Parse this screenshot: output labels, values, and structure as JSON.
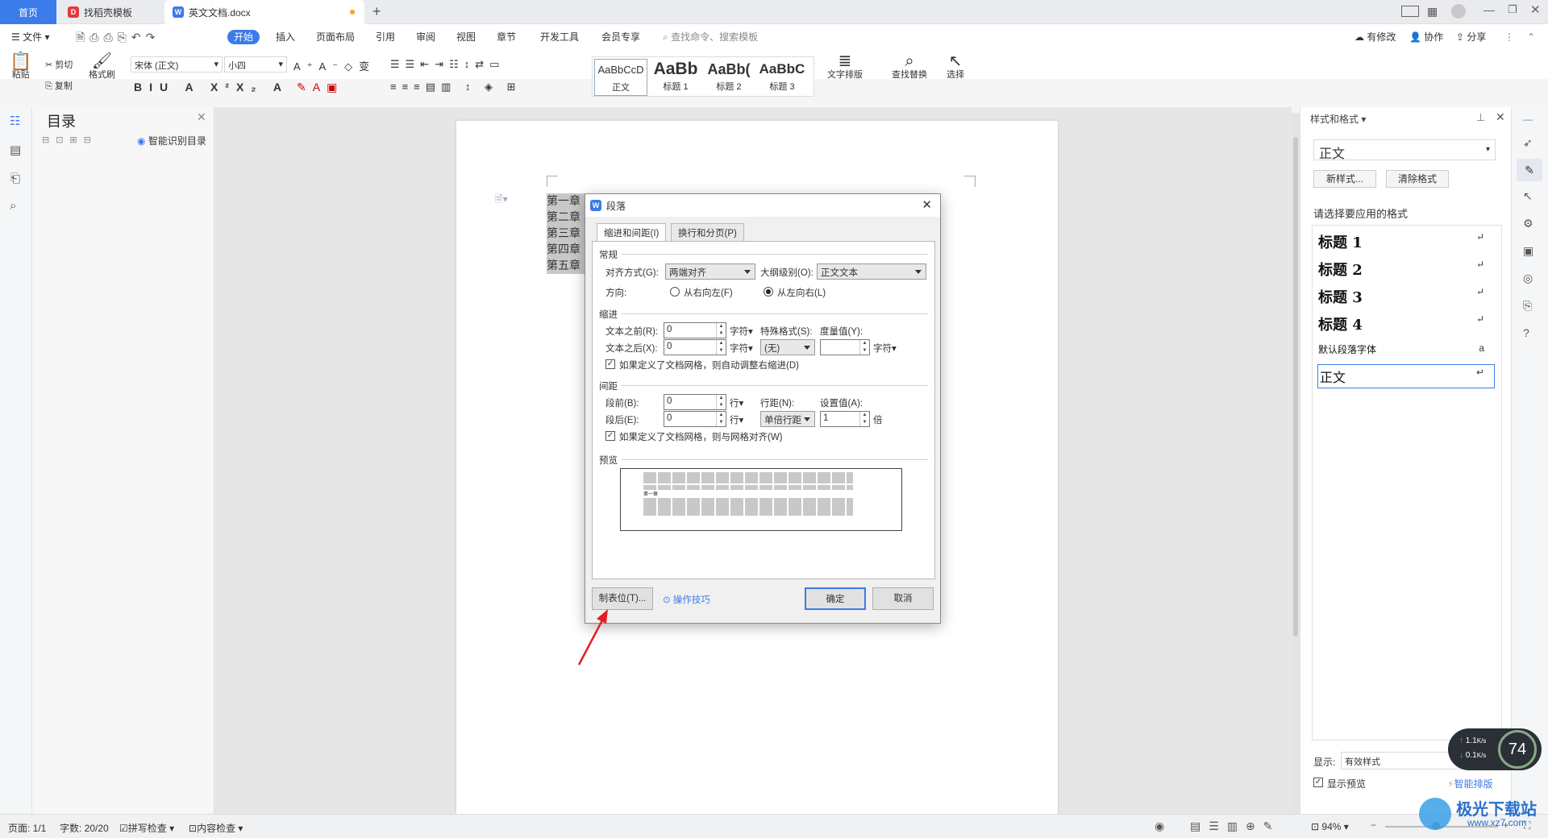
{
  "titlebar": {
    "tabs": [
      {
        "label": "首页"
      },
      {
        "label": "找稻壳模板"
      },
      {
        "label": "英文文档.docx"
      }
    ],
    "new_tab": "+"
  },
  "menubar": {
    "file": "文件",
    "items": [
      "开始",
      "插入",
      "页面布局",
      "引用",
      "审阅",
      "视图",
      "章节",
      "开发工具",
      "会员专享"
    ],
    "search_placeholder": "查找命令、搜索模板",
    "right": {
      "modify": "有修改",
      "collab": "协作",
      "share": "分享"
    }
  },
  "ribbon": {
    "paste": "粘贴",
    "cut": "剪切",
    "copy": "复制",
    "format_painter": "格式刷",
    "font_name": "宋体 (正文)",
    "font_size": "小四",
    "styles": [
      {
        "preview": "AaBbCcD",
        "label": "正文"
      },
      {
        "preview": "AaBb",
        "label": "标题 1"
      },
      {
        "preview": "AaBb(",
        "label": "标题 2"
      },
      {
        "preview": "AaBbC",
        "label": "标题 3"
      }
    ],
    "text_layout": "文字排版",
    "find_replace": "查找替换",
    "select": "选择"
  },
  "toc": {
    "title": "目录",
    "smart": "智能识别目录"
  },
  "document": {
    "lines": [
      "第一章",
      "第二章",
      "第三章",
      "第四章",
      "第五章"
    ]
  },
  "dialog": {
    "title": "段落",
    "tabs": [
      "缩进和间距(I)",
      "换行和分页(P)"
    ],
    "general": {
      "section": "常规",
      "align_label": "对齐方式(G):",
      "align_value": "两端对齐",
      "outline_label": "大纲级别(O):",
      "outline_value": "正文文本",
      "direction_label": "方向:",
      "rtl": "从右向左(F)",
      "ltr": "从左向右(L)"
    },
    "indent": {
      "section": "缩进",
      "before_label": "文本之前(R):",
      "before_value": "0",
      "after_label": "文本之后(X):",
      "after_value": "0",
      "unit": "字符",
      "special_label": "特殊格式(S):",
      "special_value": "(无)",
      "measure_label": "度量值(Y):",
      "measure_value": "",
      "auto_adjust": "如果定义了文档网格，则自动调整右缩进(D)"
    },
    "spacing": {
      "section": "间距",
      "before_label": "段前(B):",
      "before_value": "0",
      "after_label": "段后(E):",
      "after_value": "0",
      "unit": "行",
      "line_label": "行距(N):",
      "line_value": "单倍行距",
      "set_label": "设置值(A):",
      "set_value": "1",
      "set_unit": "倍",
      "grid_align": "如果定义了文档网格，则与网格对齐(W)"
    },
    "preview": {
      "section": "预览",
      "sample": "第一章"
    },
    "tabs_button": "制表位(T)...",
    "tips": "操作技巧",
    "ok": "确定",
    "cancel": "取消"
  },
  "right_panel": {
    "title": "样式和格式",
    "current": "正文",
    "new_style": "新样式...",
    "clear_format": "清除格式",
    "choose_label": "请选择要应用的格式",
    "items": [
      "标题 1",
      "标题 2",
      "标题 3",
      "标题 4",
      "默认段落字体",
      "正文"
    ],
    "show_label": "显示:",
    "show_value": "有效样式",
    "show_preview": "显示预览",
    "smart_layout": "智能排版"
  },
  "netspeed": {
    "up": "1.1",
    "down": "0.1",
    "unit": "K/s",
    "percent": "74"
  },
  "statusbar": {
    "page": "页面: 1/1",
    "words": "字数: 20/20",
    "spell": "拼写检查",
    "content": "内容检查",
    "zoom": "94%"
  },
  "watermark": {
    "site": "极光下载站",
    "url": "www.xz7.com"
  },
  "colors": {
    "accent": "#3b7bea",
    "arrow": "#e02020"
  }
}
